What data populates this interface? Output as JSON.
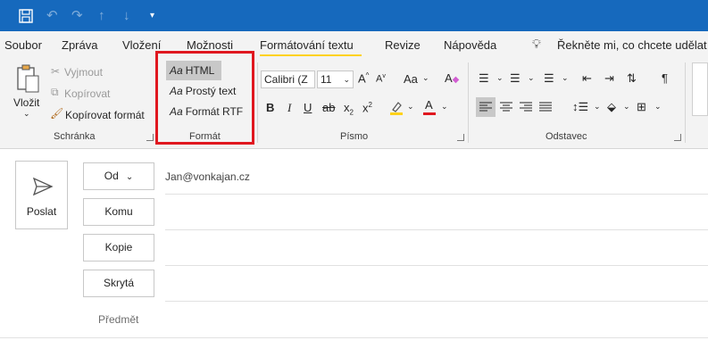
{
  "quick_access": {
    "save_icon": "save-icon",
    "undo_icon": "undo-icon",
    "redo_icon": "redo-icon",
    "up_icon": "arrow-up-icon",
    "down_icon": "arrow-down-icon",
    "customize_icon": "customize-icon"
  },
  "tabs": [
    {
      "label": "Soubor"
    },
    {
      "label": "Zpráva"
    },
    {
      "label": "Vložení"
    },
    {
      "label": "Možnosti"
    },
    {
      "label": "Formátování textu",
      "active": true
    },
    {
      "label": "Revize"
    },
    {
      "label": "Nápověda"
    }
  ],
  "tell_me": "Řekněte mi, co chcete udělat",
  "ribbon": {
    "clipboard": {
      "group_label": "Schránka",
      "paste_label": "Vložit",
      "cut_label": "Vyjmout",
      "copy_label": "Kopírovat",
      "format_painter_label": "Kopírovat formát"
    },
    "format": {
      "group_label": "Formát",
      "aa": "Aa",
      "html_label": "HTML",
      "plain_label": "Prostý text",
      "rtf_label": "Formát RTF"
    },
    "font": {
      "group_label": "Písmo",
      "font_name": "Calibri (Z",
      "font_size": "11",
      "bold": "B",
      "italic": "I",
      "underline": "U",
      "strike": "ab",
      "subscript": "x",
      "superscript": "x",
      "grow": "A",
      "shrink": "A",
      "case": "Aa",
      "font_color": "A",
      "font_color_hex": "#e0171f",
      "highlight_hex": "#ffd21a"
    },
    "paragraph": {
      "group_label": "Odstavec",
      "pilcrow": "¶"
    }
  },
  "compose": {
    "send_label": "Poslat",
    "from_label": "Od",
    "from_value": "Jan@vonkajan.cz",
    "to_label": "Komu",
    "cc_label": "Kopie",
    "bcc_label": "Skrytá",
    "subject_label": "Předmět"
  },
  "colors": {
    "titlebar": "#1669bd",
    "highlight_box": "#e0171f",
    "active_tab_underline": "#ffd21a"
  }
}
